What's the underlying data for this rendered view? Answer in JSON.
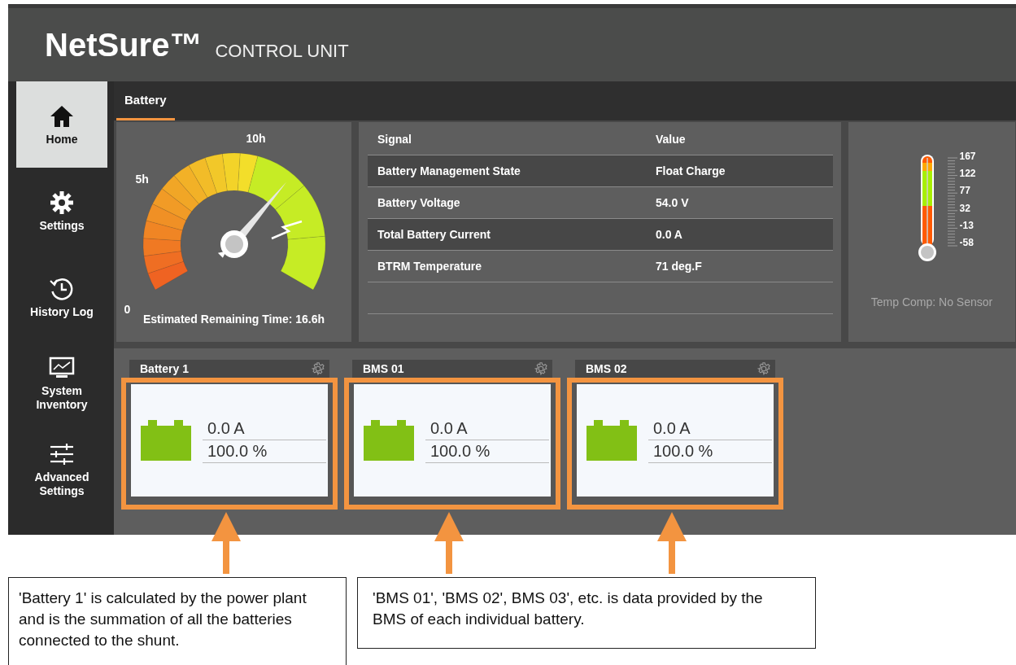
{
  "header": {
    "logo": "NetSure™",
    "subtitle": "CONTROL UNIT"
  },
  "sidebar": {
    "items": [
      {
        "label": "Home",
        "kind": "home",
        "selected": true
      },
      {
        "label": "Settings",
        "kind": "gear",
        "selected": false
      },
      {
        "label": "History Log",
        "kind": "history",
        "selected": false
      },
      {
        "label": "System Inventory",
        "kind": "monitor",
        "selected": false
      },
      {
        "label": "Advanced Settings",
        "kind": "sliders",
        "selected": false
      }
    ]
  },
  "tabs": [
    {
      "label": "Battery",
      "selected": true
    }
  ],
  "gauge": {
    "ticks": [
      "0",
      "5h",
      "10h"
    ],
    "caption": "Estimated Remaining Time: 16.6h"
  },
  "signals": {
    "columns": [
      "Signal",
      "Value"
    ],
    "rows": [
      {
        "signal": "Battery Management State",
        "value": "Float Charge"
      },
      {
        "signal": "Battery Voltage",
        "value": "54.0 V"
      },
      {
        "signal": "Total Battery Current",
        "value": "0.0 A"
      },
      {
        "signal": "BTRM Temperature",
        "value": "71 deg.F"
      }
    ]
  },
  "thermometer": {
    "scale": [
      "167",
      "122",
      "77",
      "32",
      "-13",
      "-58"
    ],
    "caption": "Temp Comp: No Sensor"
  },
  "cards": [
    {
      "title": "Battery 1",
      "current": "0.0 A",
      "charge": "100.0 %"
    },
    {
      "title": "BMS 01",
      "current": "0.0 A",
      "charge": "100.0 %"
    },
    {
      "title": "BMS 02",
      "current": "0.0 A",
      "charge": "100.0 %"
    }
  ],
  "callouts": [
    {
      "text": "'Battery 1' is calculated by the power plant and is the summation of all the batteries connected to the shunt."
    },
    {
      "text": "'BMS 01', 'BMS 02', BMS 03', etc. is data provided by the BMS of each individual battery."
    }
  ]
}
